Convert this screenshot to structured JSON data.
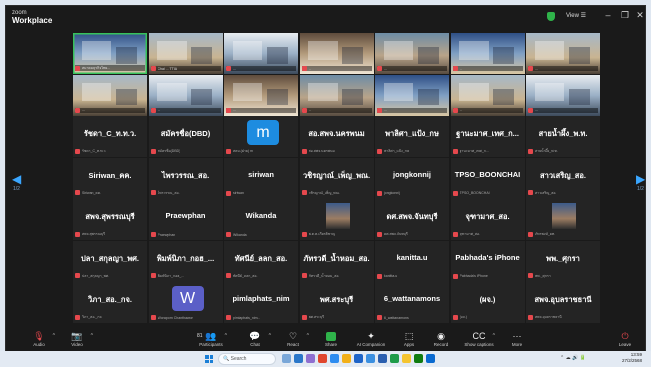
{
  "app": {
    "brand_top": "zoom",
    "brand_bottom": "Workplace",
    "view_label": "View"
  },
  "pages": {
    "left": "1/2",
    "right": "1/2"
  },
  "video_row_1": [
    {
      "label": "สมาคมธุรกิจไทย...",
      "hl": true
    },
    {
      "label": "Chai ... TTIA"
    },
    {
      "label": "..."
    },
    {
      "label": "..."
    },
    {
      "label": "..."
    },
    {
      "label": "..."
    },
    {
      "label": "..."
    }
  ],
  "video_row_2": [
    {
      "label": "..."
    },
    {
      "label": "..."
    },
    {
      "label": "..."
    },
    {
      "label": "..."
    },
    {
      "label": "..."
    },
    {
      "label": "..."
    },
    {
      "label": "..."
    }
  ],
  "tiles": [
    {
      "name": "รัชดา_C_ท.ท.ว.",
      "sub": "รัชดา_C_ท.ท.ว."
    },
    {
      "name": "สมัครชื่อ(DBD)",
      "sub": "สมัครชื่อ(DBD)"
    },
    {
      "name": "",
      "sub": "สคบ.(ฝ่าย) m",
      "avatar": "m",
      "avatar_color": "#1d8ce0"
    },
    {
      "name": "สอ.สพจ.นครพนม",
      "sub": "สอ.สพจ.นครพนม"
    },
    {
      "name": "พาลิศา_แป้ง_กษ",
      "sub": "พาลิศา_แป้ง_กษ"
    },
    {
      "name": "ฐานะมาศ_เทศ_ก...",
      "sub": "ฐานะมาศ_เทศ_ก..."
    },
    {
      "name": "สายน้ำผึ้ง_พ.ท.",
      "sub": "สายน้ำผึ้ง_พ.ท."
    },
    {
      "name": "Siriwan_คค.",
      "sub": "Siriwan_คค."
    },
    {
      "name": "ไพรวรรณ_สอ.",
      "sub": "ไพรวรรณ_สอ."
    },
    {
      "name": "siriwan",
      "sub": "siriwan"
    },
    {
      "name": "วชิรญาณ์_เพ็ญ_พณ.",
      "sub": "วชิรญาณ์_เพ็ญ_พณ."
    },
    {
      "name": "jongkonnij",
      "sub": "jongkonnij"
    },
    {
      "name": "TPSO_BOONCHAI",
      "sub": "TPSO_BOONCHAI"
    },
    {
      "name": "สาวเสริญ_สอ.",
      "sub": "สาวเสริญ_สอ."
    },
    {
      "name": "สพจ.สุพรรณบุรี",
      "sub": "สพจ.สุพรรณบุรี"
    },
    {
      "name": "Praewphan",
      "sub": "Praewphan"
    },
    {
      "name": "Wikanda",
      "sub": "Wikanda"
    },
    {
      "name": "",
      "sub": "พ.ต.ต.เกียรติชาญ",
      "photo": true
    },
    {
      "name": "ดศ.สพจ.จันทบุรี",
      "sub": "ดศ.สพจ.จันทบุรี"
    },
    {
      "name": "จุฑามาศ_สอ.",
      "sub": "จุฑามาศ_สอ."
    },
    {
      "name": "",
      "sub": "ภัทรพงษ์_ยท.",
      "photo": true
    },
    {
      "name": "ปลา_สกุลญา_พศ.",
      "sub": "ปลา_สกุลญา_พศ."
    },
    {
      "name": "พิมพ์นิภา_กอฮ_...",
      "sub": "พิมพ์นิภา_กอฮ_..."
    },
    {
      "name": "ทัศนีย์_ลลก_สอ.",
      "sub": "ทัศนีย์_ลลก_สอ."
    },
    {
      "name": "ภัทรวดี_น้ำหอม_สอ.",
      "sub": "ภัทรวดี_น้ำหอม_สอ."
    },
    {
      "name": "kanitta.u",
      "sub": "kanitta.u"
    },
    {
      "name": "Pabhada's iPhone",
      "sub": "Pabhada's iPhone"
    },
    {
      "name": "พพ._ศุกรา",
      "sub": "พพ._ศุกรา"
    },
    {
      "name": "วิภา_สอ._กจ.",
      "sub": "วิภา_สอ._กจ."
    },
    {
      "name": "",
      "sub": "Woraporn Chanthawon",
      "avatar": "W",
      "avatar_color": "#5b5fc7"
    },
    {
      "name": "pimlaphats_nim",
      "sub": "pimlaphats_nim..."
    },
    {
      "name": "พศ.สระบุรี",
      "sub": "พศ.สระบุรี"
    },
    {
      "name": "6_wattanamons",
      "sub": "6_wattanamons"
    },
    {
      "name": "(ผจ.)",
      "sub": "(ผจ.)"
    },
    {
      "name": "สพจ.อุบลราชธานี",
      "sub": "สพจ.อุบลราชธานี"
    }
  ],
  "toolbar": [
    {
      "id": "audio",
      "label": "Audio",
      "icon": "🎙",
      "red": true,
      "caret": true
    },
    {
      "id": "video",
      "label": "Video",
      "icon": "📷",
      "red": true,
      "caret": true
    },
    {
      "id": "participants",
      "label": "Participants",
      "icon": "👥",
      "count": "81",
      "caret": true
    },
    {
      "id": "chat",
      "label": "Chat",
      "icon": "💬",
      "caret": true
    },
    {
      "id": "react",
      "label": "React",
      "icon": "♡",
      "caret": true
    },
    {
      "id": "share",
      "label": "Share",
      "icon": "⬆",
      "green": true
    },
    {
      "id": "ai",
      "label": "AI Companion",
      "icon": "✦"
    },
    {
      "id": "apps",
      "label": "Apps",
      "icon": "⬚"
    },
    {
      "id": "record",
      "label": "Record",
      "icon": "◉"
    },
    {
      "id": "captions",
      "label": "Show captions",
      "icon": "CC",
      "caret": true
    },
    {
      "id": "more",
      "label": "More",
      "icon": "···"
    }
  ],
  "leave_label": "Leave",
  "taskbar": {
    "search_placeholder": "Search",
    "time": "13:59",
    "date": "27/2/2568"
  },
  "colors": {
    "mic_off": "#e5484d",
    "active_speaker": "#37c15b",
    "accent": "#1d8ce0"
  }
}
